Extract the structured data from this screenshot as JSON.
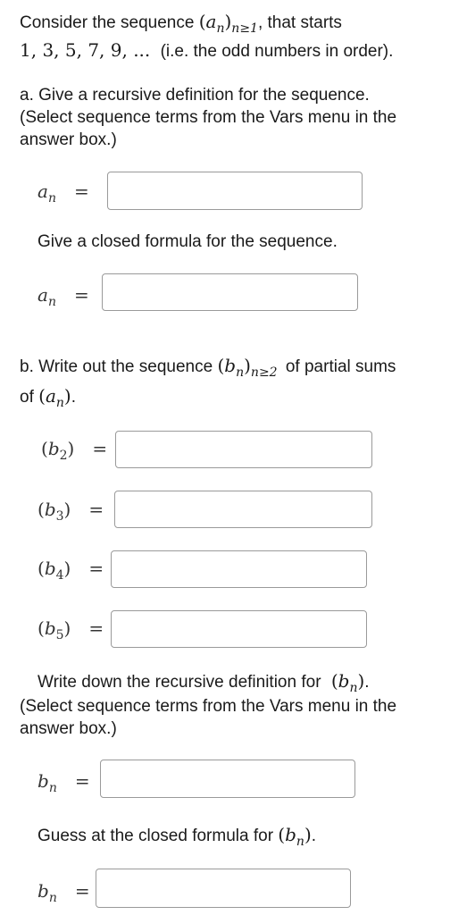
{
  "intro": {
    "line1_prefix": "Consider the sequence",
    "line1_seq_letter": "a",
    "line1_seq_index": "n",
    "line1_seq_range": "n≥1",
    "line1_suffix": ", that starts",
    "line2_terms": "1, 3, 5, 7, 9, ...",
    "line2_note": "(i.e. the odd numbers in order)."
  },
  "part_a": {
    "prompt_lines": [
      "a. Give a recursive definition for the sequence.",
      "(Select sequence terms from the Vars menu in the",
      "answer box.)"
    ],
    "recursive_label_letter": "a",
    "recursive_label_index": "n",
    "recursive_value": "",
    "closed_prompt": "Give a closed formula for the sequence.",
    "closed_label_letter": "a",
    "closed_label_index": "n",
    "closed_value": ""
  },
  "part_b": {
    "prompt_prefix": "b. Write out the sequence",
    "prompt_seq_letter": "b",
    "prompt_seq_index": "n",
    "prompt_seq_range": "n≥2",
    "prompt_suffix": "of partial sums",
    "prompt_line2_prefix": "of",
    "prompt_line2_letter": "a",
    "prompt_line2_index": "n",
    "terms": [
      {
        "letter": "b",
        "index": "2",
        "value": ""
      },
      {
        "letter": "b",
        "index": "3",
        "value": ""
      },
      {
        "letter": "b",
        "index": "4",
        "value": ""
      },
      {
        "letter": "b",
        "index": "5",
        "value": ""
      }
    ],
    "recursive_prompt_lines": [
      "Write down the recursive definition for",
      "(Select sequence terms from the Vars menu in the",
      "answer box.)"
    ],
    "recursive_prompt_letter": "b",
    "recursive_prompt_index": "n",
    "recursive_label_letter": "b",
    "recursive_label_index": "n",
    "recursive_value": "",
    "closed_prompt": "Guess at the closed formula for",
    "closed_prompt_letter": "b",
    "closed_prompt_index": "n",
    "closed_label_letter": "b",
    "closed_label_index": "n",
    "closed_value": ""
  },
  "symbols": {
    "equals": "=",
    "lparen": "(",
    "rparen": ")",
    "period": "."
  }
}
